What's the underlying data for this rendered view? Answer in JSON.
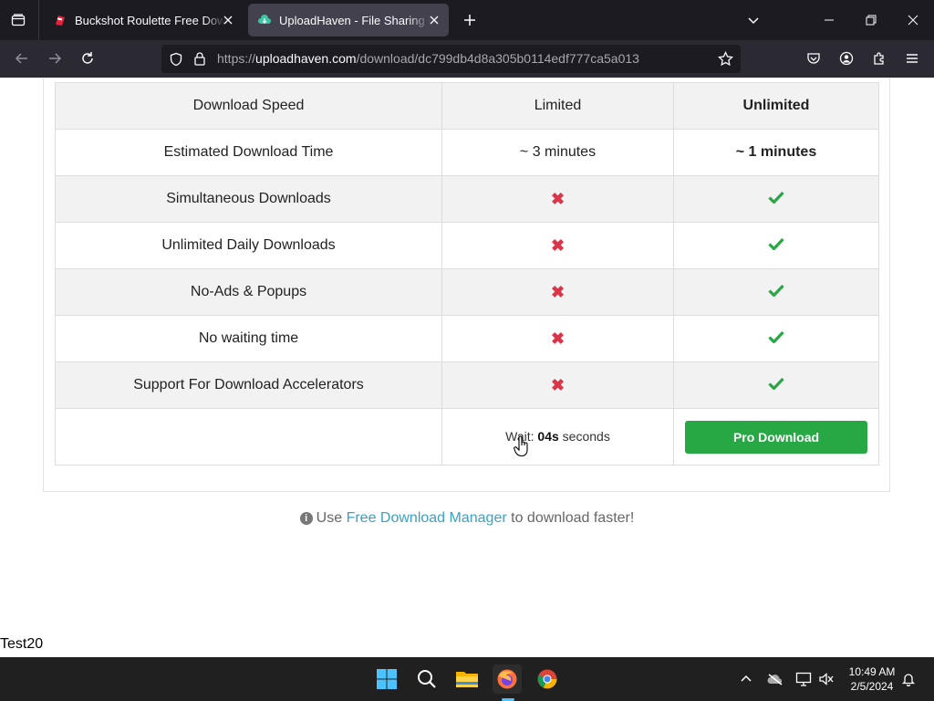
{
  "browser": {
    "tabs": [
      {
        "title": "Buckshot Roulette Free Download",
        "active": false
      },
      {
        "title": "UploadHaven - File Sharing Made Simple",
        "active": true
      }
    ],
    "url": {
      "prefix": "https://",
      "host": "uploadhaven.com",
      "path": "/download/dc799db4d8a305b0114edf777ca5a013"
    }
  },
  "comparison": {
    "rows": [
      {
        "feature": "Download Speed",
        "free": "Limited",
        "pro": "Unlimited"
      },
      {
        "feature": "Estimated Download Time",
        "free": "~ 3 minutes",
        "pro": "~ 1 minutes"
      },
      {
        "feature": "Simultaneous Downloads",
        "free": "✖",
        "pro": "check"
      },
      {
        "feature": "Unlimited Daily Downloads",
        "free": "✖",
        "pro": "check"
      },
      {
        "feature": "No-Ads & Popups",
        "free": "✖",
        "pro": "check"
      },
      {
        "feature": "No waiting time",
        "free": "✖",
        "pro": "check"
      },
      {
        "feature": "Support For Download Accelerators",
        "free": "✖",
        "pro": "check"
      }
    ],
    "wait": {
      "prefix": "Wait:",
      "count": "04s",
      "suffix": "seconds"
    },
    "pro_button": "Pro Download"
  },
  "tip": {
    "use": "Use",
    "link": "Free Download Manager",
    "rest": "to download faster!"
  },
  "page_label": "Test20",
  "taskbar": {
    "time": "10:49 AM",
    "date": "2/5/2024"
  },
  "colors": {
    "accent_green": "#28a745",
    "cross_red": "#d9364a",
    "link_blue": "#3aa1c5"
  }
}
